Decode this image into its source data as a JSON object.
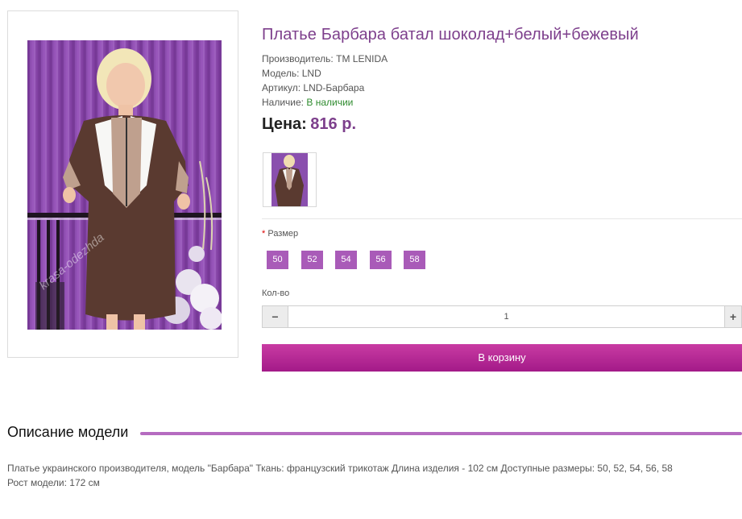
{
  "product": {
    "title": "Платье Барбара батал шоколад+белый+бежевый",
    "manufacturer_label": "Производитель:",
    "manufacturer": "TM LENIDA",
    "model_label": "Модель:",
    "model": "LND",
    "sku_label": "Артикул:",
    "sku": "LND-Барбара",
    "availability_label": "Наличие:",
    "availability": "В наличии",
    "price_label": "Цена:",
    "price": "816 р.",
    "watermark": "krasa-odezhda"
  },
  "options": {
    "required_mark": "*",
    "size_label": "Размер",
    "sizes": [
      "50",
      "52",
      "54",
      "56",
      "58"
    ]
  },
  "quantity": {
    "label": "Кол-во",
    "minus": "−",
    "plus": "+",
    "value": "1"
  },
  "cart": {
    "button_label": "В корзину"
  },
  "description": {
    "heading": "Описание модели",
    "line1": "Платье украинского производителя, модель \"Барбара\" Ткань: французский трикотаж Длина изделия - 102 см Доступные размеры: 50, 52, 54, 56, 58",
    "line2": "Рост модели: 172 см"
  },
  "colors": {
    "accent_purple": "#7d3f8c",
    "size_button": "#a95bb8",
    "cart_button": "#b82a95",
    "in_stock": "#2e8b2e",
    "divider_line": "#b56bc0"
  }
}
